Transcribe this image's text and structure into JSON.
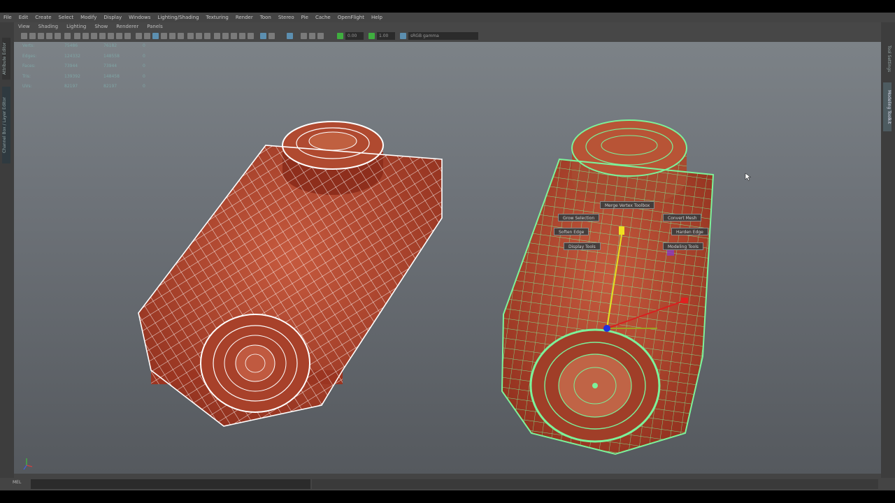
{
  "menubar": {
    "items": [
      "File",
      "Edit",
      "Create",
      "Select",
      "Modify",
      "Display",
      "Windows",
      "Lighting/Shading",
      "Texturing",
      "Render",
      "Toon",
      "Stereo",
      "Pie",
      "Cache",
      "OpenFlight",
      "Help"
    ]
  },
  "panel_menu": {
    "items": [
      "View",
      "Shading",
      "Lighting",
      "Show",
      "Renderer",
      "Panels"
    ]
  },
  "toolbar": {
    "field_1": "0.00",
    "field_2": "1.00",
    "color_space": "sRGB gamma"
  },
  "side_tabs": {
    "left_top": "Attribute Editor",
    "left_bottom": "Channel Box / Layer Editor",
    "right_top": "Tool Settings",
    "right_bottom": "Modeling Toolkit"
  },
  "poly_stats": [
    {
      "label": "Verts:",
      "a": "75486",
      "b": "76182",
      "c": "0"
    },
    {
      "label": "Edges:",
      "a": "124332",
      "b": "148558",
      "c": "0"
    },
    {
      "label": "Faces:",
      "a": "73944",
      "b": "73944",
      "c": "0"
    },
    {
      "label": "Tris:",
      "a": "139392",
      "b": "148458",
      "c": "0"
    },
    {
      "label": "UVs:",
      "a": "82197",
      "b": "82197",
      "c": "0"
    }
  ],
  "marking_menu": {
    "top": "Merge Vertex Toolbox",
    "upper_left": "Grow Selection",
    "upper_right": "Convert Mesh",
    "left": "Soften Edge",
    "right": "Harden Edge",
    "lower_left": "Display Tools",
    "lower_right": "Modeling Tools"
  },
  "command_line": {
    "label": "MEL"
  },
  "colors": {
    "mesh_red": "#b4412a",
    "wire_white": "#ffffff",
    "wire_green": "#7cf29a",
    "ui_bg": "#444444"
  }
}
